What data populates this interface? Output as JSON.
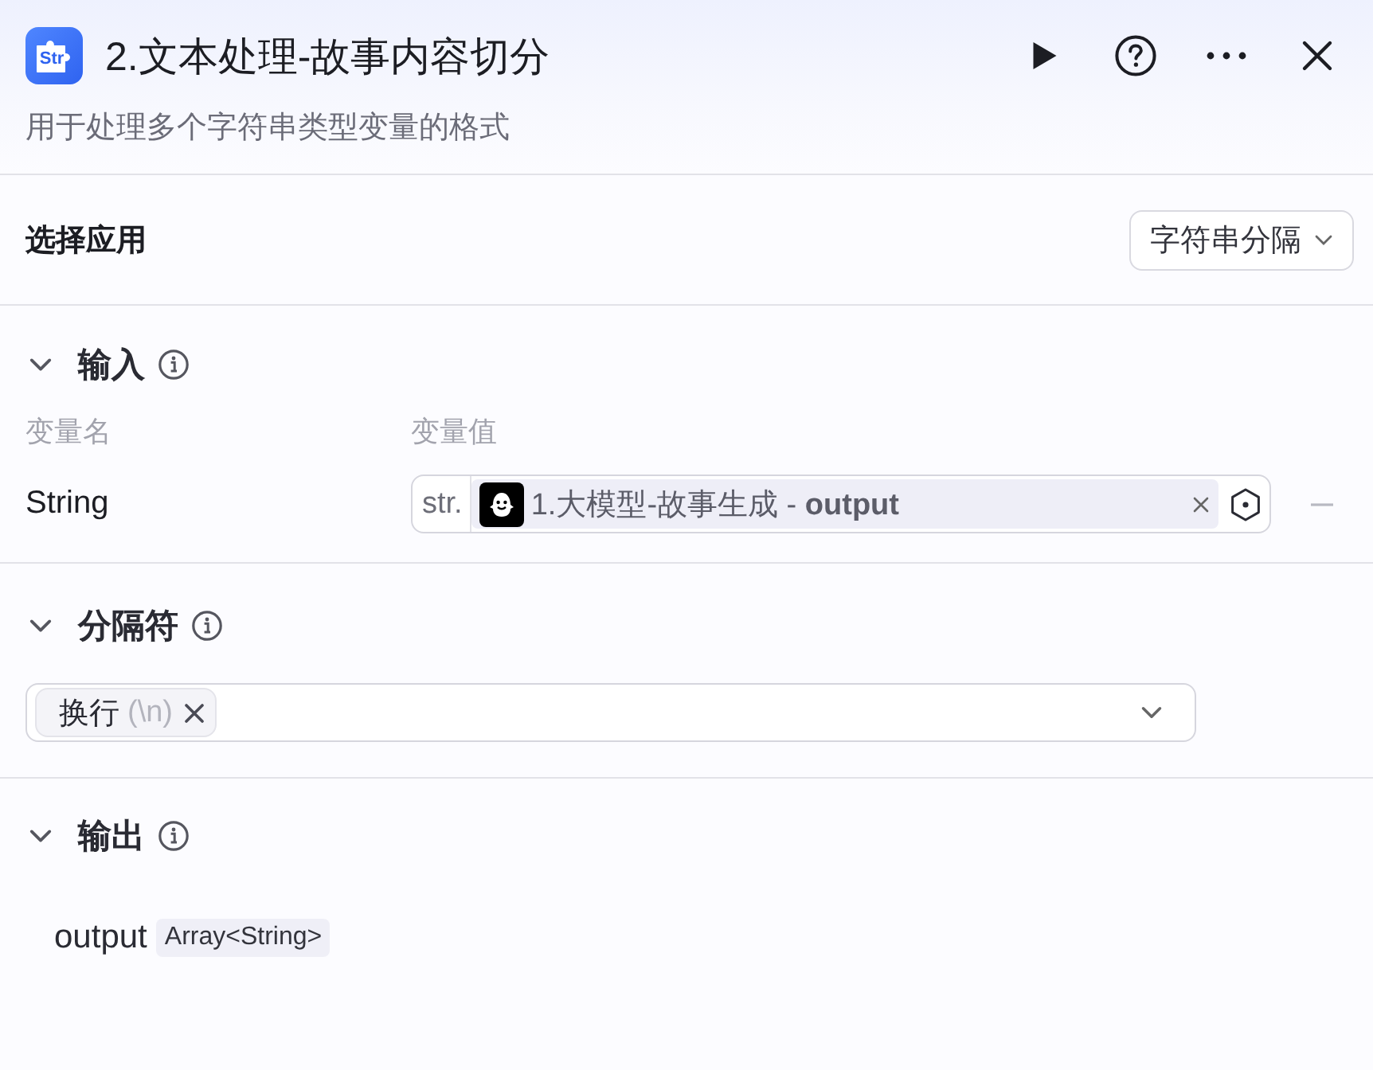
{
  "header": {
    "logo_label": "Str",
    "title": "2.文本处理-故事内容切分",
    "description": "用于处理多个字符串类型变量的格式"
  },
  "app_select": {
    "label": "选择应用",
    "value": "字符串分隔"
  },
  "sections": [
    {
      "kind": "inputs",
      "title": "输入",
      "expanded": true,
      "columns": [
        "变量名",
        "变量值"
      ],
      "rows": [
        {
          "name": "String",
          "value_type": "str.",
          "reference": "1.大模型-故事生成 - **output**"
        }
      ]
    },
    {
      "kind": "separator",
      "title": "分隔符",
      "expanded": true,
      "tags": [
        {
          "label": "换行",
          "hint": "(\\n)"
        }
      ]
    },
    {
      "kind": "outputs",
      "title": "输出",
      "expanded": true,
      "rows": [
        {
          "name": "output",
          "type": "Array<String>"
        }
      ]
    }
  ]
}
